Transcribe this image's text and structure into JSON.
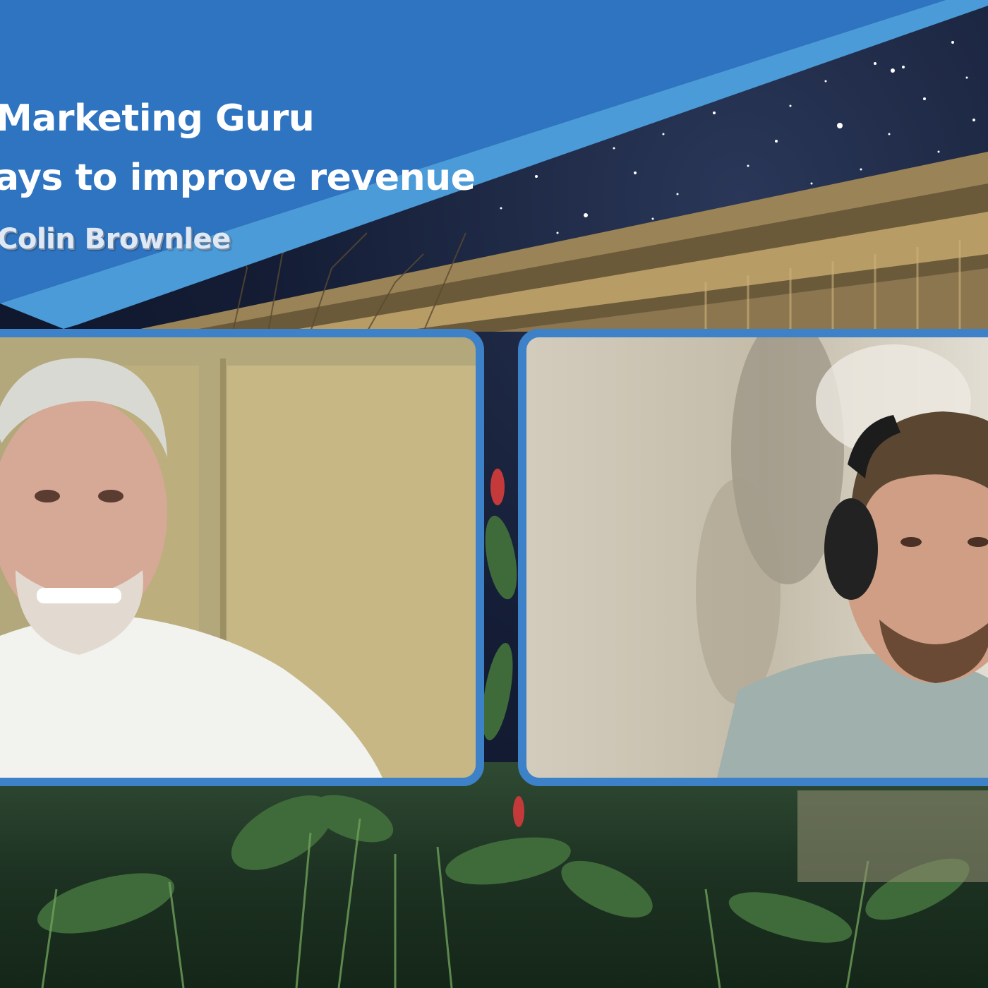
{
  "banner": {
    "title": "Marketing Guru",
    "subtitle": "ays to improve revenue",
    "guest": "Colin Brownlee",
    "colors": {
      "primary": "#2f74c0",
      "accent_stripe": "#4b9bd9"
    }
  },
  "participants": [
    {
      "name": "",
      "description": "left-video-tile"
    },
    {
      "name": "",
      "description": "right-video-tile"
    }
  ],
  "theme": {
    "tile_border": "#3d82c8"
  }
}
